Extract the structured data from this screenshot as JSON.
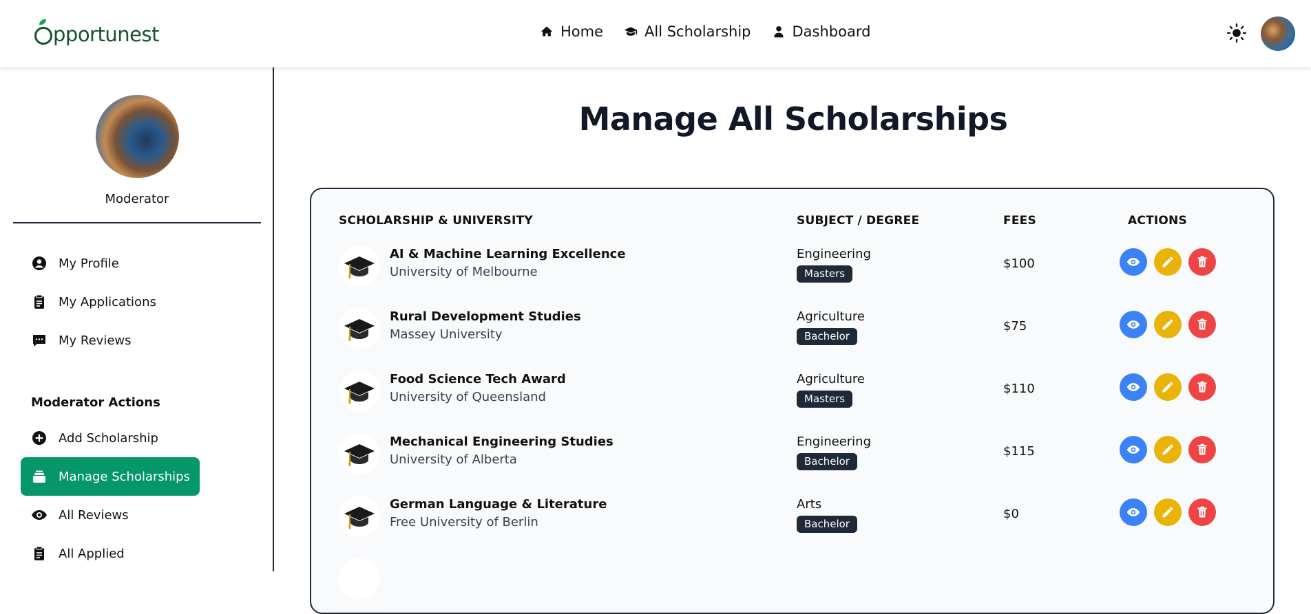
{
  "navbar": {
    "logo_text": "pportunest",
    "links": [
      {
        "label": "Home",
        "icon": "home-icon"
      },
      {
        "label": "All Scholarship",
        "icon": "graduation-cap-icon"
      },
      {
        "label": "Dashboard",
        "icon": "user-icon"
      }
    ],
    "theme_icon": "sun-icon"
  },
  "sidebar": {
    "role": "Moderator",
    "items": [
      {
        "label": "My Profile",
        "icon": "user-circle-icon"
      },
      {
        "label": "My Applications",
        "icon": "clipboard-icon"
      },
      {
        "label": "My Reviews",
        "icon": "comment-icon"
      }
    ],
    "section_title": "Moderator Actions",
    "moderator_items": [
      {
        "label": "Add Scholarship",
        "icon": "plus-circle-icon"
      },
      {
        "label": "Manage Scholarships",
        "icon": "layers-icon",
        "active": true
      },
      {
        "label": "All Reviews",
        "icon": "eye-icon"
      },
      {
        "label": "All Applied",
        "icon": "clipboard-icon"
      }
    ]
  },
  "main": {
    "title": "Manage All Scholarships",
    "columns": [
      "SCHOLARSHIP & UNIVERSITY",
      "SUBJECT / DEGREE",
      "FEES",
      "ACTIONS"
    ],
    "rows": [
      {
        "name": "AI & Machine Learning Excellence",
        "university": "University of Melbourne",
        "subject": "Engineering",
        "degree": "Masters",
        "fee": "$100"
      },
      {
        "name": "Rural Development Studies",
        "university": "Massey University",
        "subject": "Agriculture",
        "degree": "Bachelor",
        "fee": "$75"
      },
      {
        "name": "Food Science Tech Award",
        "university": "University of Queensland",
        "subject": "Agriculture",
        "degree": "Masters",
        "fee": "$110"
      },
      {
        "name": "Mechanical Engineering Studies",
        "university": "University of Alberta",
        "subject": "Engineering",
        "degree": "Bachelor",
        "fee": "$115"
      },
      {
        "name": "German Language & Literature",
        "university": "Free University of Berlin",
        "subject": "Arts",
        "degree": "Bachelor",
        "fee": "$0"
      }
    ]
  },
  "colors": {
    "accent": "#059669",
    "view": "#3b82f6",
    "edit": "#eab308",
    "delete": "#ef4444",
    "badge": "#1f2937"
  }
}
